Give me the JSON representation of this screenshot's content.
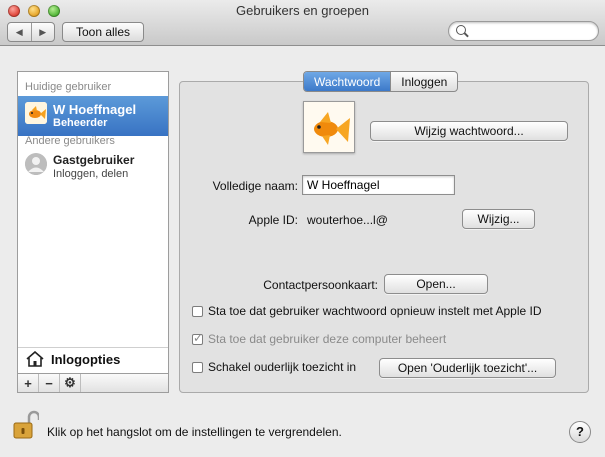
{
  "window": {
    "title": "Gebruikers en groepen",
    "nav_back": "◀",
    "nav_forward": "▶",
    "show_all": "Toon alles",
    "search_placeholder": ""
  },
  "sidebar": {
    "current_header": "Huidige gebruiker",
    "current_user": {
      "name": "W Hoeffnagel",
      "role": "Beheerder"
    },
    "other_header": "Andere gebruikers",
    "other_users": [
      {
        "name": "Gastgebruiker",
        "role": "Inloggen, delen"
      }
    ],
    "login_options": "Inlogopties",
    "add": "+",
    "remove": "−",
    "settings": "⚙"
  },
  "tabs": [
    {
      "label": "Wachtwoord",
      "active": true
    },
    {
      "label": "Inloggen",
      "active": false
    }
  ],
  "password": {
    "change_password": "Wijzig wachtwoord...",
    "full_name_label": "Volledige naam:",
    "full_name_value": "W Hoeffnagel",
    "apple_id_label": "Apple ID:",
    "apple_id_value": "wouterhoe...l@",
    "apple_id_change": "Wijzig...",
    "contact_card_label": "Contactpersoonkaart:",
    "contact_card_open": "Open...",
    "allow_reset": "Sta toe dat gebruiker wachtwoord opnieuw instelt met Apple ID",
    "allow_admin": "Sta toe dat gebruiker deze computer beheert",
    "parental": "Schakel ouderlijk toezicht in",
    "parental_open": "Open 'Ouderlijk toezicht'..."
  },
  "footer": {
    "lock_text": "Klik op het hangslot om de instellingen te vergrendelen.",
    "help": "?"
  },
  "colors": {
    "selection": "#3f7bc8",
    "accent": "#4a8ad6"
  }
}
